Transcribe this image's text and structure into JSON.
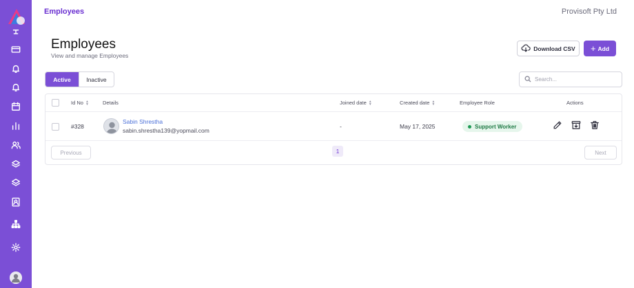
{
  "header": {
    "breadcrumb": "Employees",
    "company": "Provisoft Pty Ltd"
  },
  "page": {
    "title": "Employees",
    "subtitle": "View and manage Employees"
  },
  "toolbar": {
    "download_label": "Download CSV",
    "add_label": "Add",
    "add_icon": "+"
  },
  "tabs": [
    {
      "label": "Active",
      "selected": true
    },
    {
      "label": "Inactive",
      "selected": false
    }
  ],
  "search": {
    "placeholder": "Search..."
  },
  "table": {
    "columns": {
      "id": "Id No",
      "details": "Details",
      "joined": "Joined date",
      "created": "Created date",
      "role": "Employee Role",
      "actions": "Actions"
    },
    "rows": [
      {
        "id": "#328",
        "name": "Sabin Shrestha",
        "email": "sabin.shrestha139@yopmail.com",
        "joined": "-",
        "created": "May 17, 2025",
        "role": "Support Worker"
      }
    ]
  },
  "pagination": {
    "previous": "Previous",
    "current_page": "1",
    "next": "Next"
  },
  "sidebar": {
    "icons": [
      "monitor-icon",
      "card-icon",
      "bell-icon",
      "bell-icon",
      "calendar-icon",
      "bar-chart-icon",
      "users-icon",
      "layers-icon",
      "layers-icon",
      "contact-icon",
      "org-chart-icon",
      "gear-icon"
    ]
  },
  "colors": {
    "accent": "#7b4fd6",
    "role_badge_bg": "#e6f6ec",
    "role_badge_text": "#1f7a45"
  }
}
